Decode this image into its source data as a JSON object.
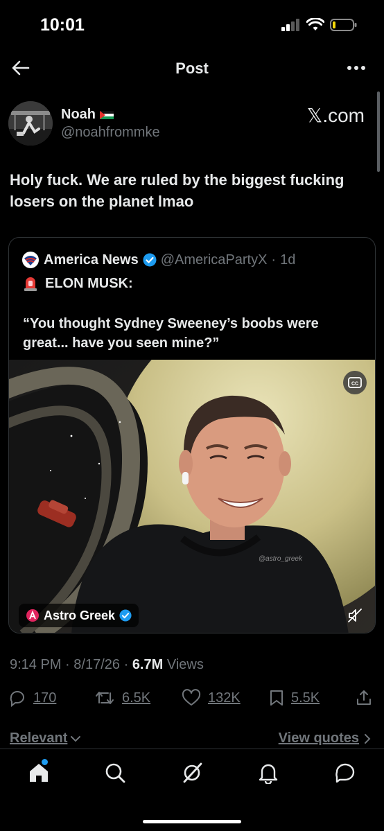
{
  "status_bar": {
    "time": "10:01"
  },
  "header": {
    "title": "Post"
  },
  "author": {
    "name": "Noah",
    "handle": "@noahfrommke",
    "source": "𝕏.com"
  },
  "post": {
    "text": "Holy fuck. We are ruled by the biggest fucking losers on the planet lmao"
  },
  "quote": {
    "name": "America News",
    "handle": "@AmericaPartyX",
    "dot": "·",
    "age": "1d",
    "line1": "ELON MUSK:",
    "text": "“You thought Sydney Sweeney’s boobs were great... have you seen mine?”",
    "media": {
      "credit": "Astro Greek",
      "watermark": "@astro_greek",
      "cc_label": "CC"
    }
  },
  "meta": {
    "time": "9:14 PM",
    "date": "8/17/26",
    "sep": "·",
    "views_count": "6.7M",
    "views_label": "Views"
  },
  "actions": {
    "replies": "170",
    "reposts": "6.5K",
    "likes": "132K",
    "bookmarks": "5.5K"
  },
  "filter": {
    "sort": "Relevant",
    "view_quotes": "View quotes"
  },
  "colors": {
    "accent": "#1d9bf0",
    "text": "#e7e9ea",
    "secondary": "#71767b",
    "border": "#2f3336",
    "background": "#000000"
  },
  "icons": {
    "nav": [
      "home-icon",
      "search-icon",
      "grok-icon",
      "notifications-icon",
      "messages-icon"
    ],
    "actions": [
      "reply-icon",
      "repost-icon",
      "like-icon",
      "bookmark-icon",
      "share-icon"
    ]
  }
}
